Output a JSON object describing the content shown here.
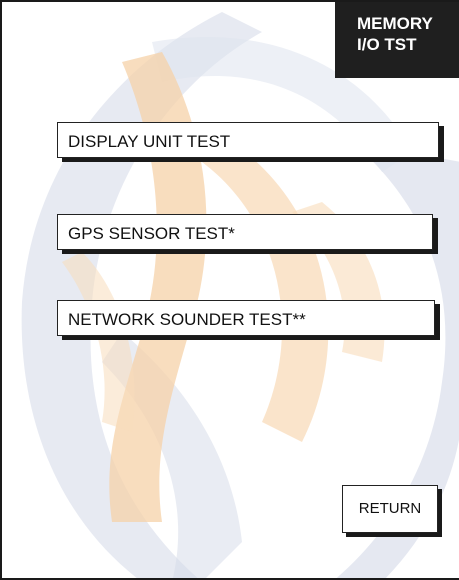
{
  "softkey": {
    "line1": "MEMORY",
    "line2": "I/O TST"
  },
  "menu": {
    "items": [
      {
        "label": "DISPLAY UNIT TEST"
      },
      {
        "label": "GPS SENSOR TEST*"
      },
      {
        "label": "NETWORK SOUNDER TEST**"
      }
    ]
  },
  "return_label": "RETURN",
  "colors": {
    "watermark_orange": "#f6d2a8",
    "watermark_blue": "#d4d9e8",
    "softkey_bg": "#1f1f1f",
    "button_shadow": "#1a1a1a"
  }
}
